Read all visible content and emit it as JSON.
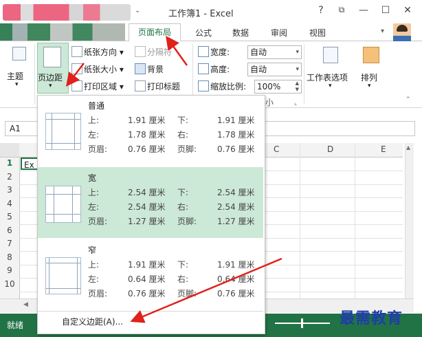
{
  "window": {
    "title": "工作簿1 - Excel",
    "help": "?",
    "buttons": {
      "restore_ribbon": "⧉",
      "minimize": "—",
      "maximize": "☐",
      "close": "✕"
    }
  },
  "tabs": {
    "page_layout": "页面布局",
    "formulas": "公式",
    "data": "数据",
    "review": "审阅",
    "view": "视图"
  },
  "ribbon": {
    "themes": "主题",
    "margins": "页边距",
    "orientation": "纸张方向",
    "size": "纸张大小",
    "print_area": "打印区域",
    "breaks": "分隔符",
    "background": "背景",
    "print_titles": "打印标题",
    "width_label": "宽度:",
    "height_label": "高度:",
    "scale_label": "缩放比例:",
    "width_value": "自动",
    "height_value": "自动",
    "scale_value": "100%",
    "group_suffix": "小",
    "sheet_options": "工作表选项",
    "arrange": "排列"
  },
  "formula_bar": {
    "name_box": "A1"
  },
  "grid": {
    "columns": [
      "C",
      "D",
      "E"
    ],
    "rows": [
      "1",
      "2",
      "3",
      "4",
      "5",
      "6",
      "7",
      "8",
      "9",
      "10"
    ],
    "cell_a1": "Ex"
  },
  "margins_menu": {
    "options": [
      {
        "name": "普通",
        "top_label": "上:",
        "top": "1.91 厘米",
        "bottom_label": "下:",
        "bottom": "1.91 厘米",
        "left_label": "左:",
        "left": "1.78 厘米",
        "right_label": "右:",
        "right": "1.78 厘米",
        "header_label": "页眉:",
        "header": "0.76 厘米",
        "footer_label": "页脚:",
        "footer": "0.76 厘米"
      },
      {
        "name": "宽",
        "top_label": "上:",
        "top": "2.54 厘米",
        "bottom_label": "下:",
        "bottom": "2.54 厘米",
        "left_label": "左:",
        "left": "2.54 厘米",
        "right_label": "右:",
        "right": "2.54 厘米",
        "header_label": "页眉:",
        "header": "1.27 厘米",
        "footer_label": "页脚:",
        "footer": "1.27 厘米"
      },
      {
        "name": "窄",
        "top_label": "上:",
        "top": "1.91 厘米",
        "bottom_label": "下:",
        "bottom": "1.91 厘米",
        "left_label": "左:",
        "left": "0.64 厘米",
        "right_label": "右:",
        "right": "0.64 厘米",
        "header_label": "页眉:",
        "header": "0.76 厘米",
        "footer_label": "页脚:",
        "footer": "0.76 厘米"
      }
    ],
    "custom": "自定义边距(A)..."
  },
  "status": {
    "ready": "就绪"
  },
  "watermark": "最需教育",
  "colors": {
    "excel_green": "#217346",
    "selected_option": "#cce8d6",
    "arrow_red": "#e0211c"
  }
}
